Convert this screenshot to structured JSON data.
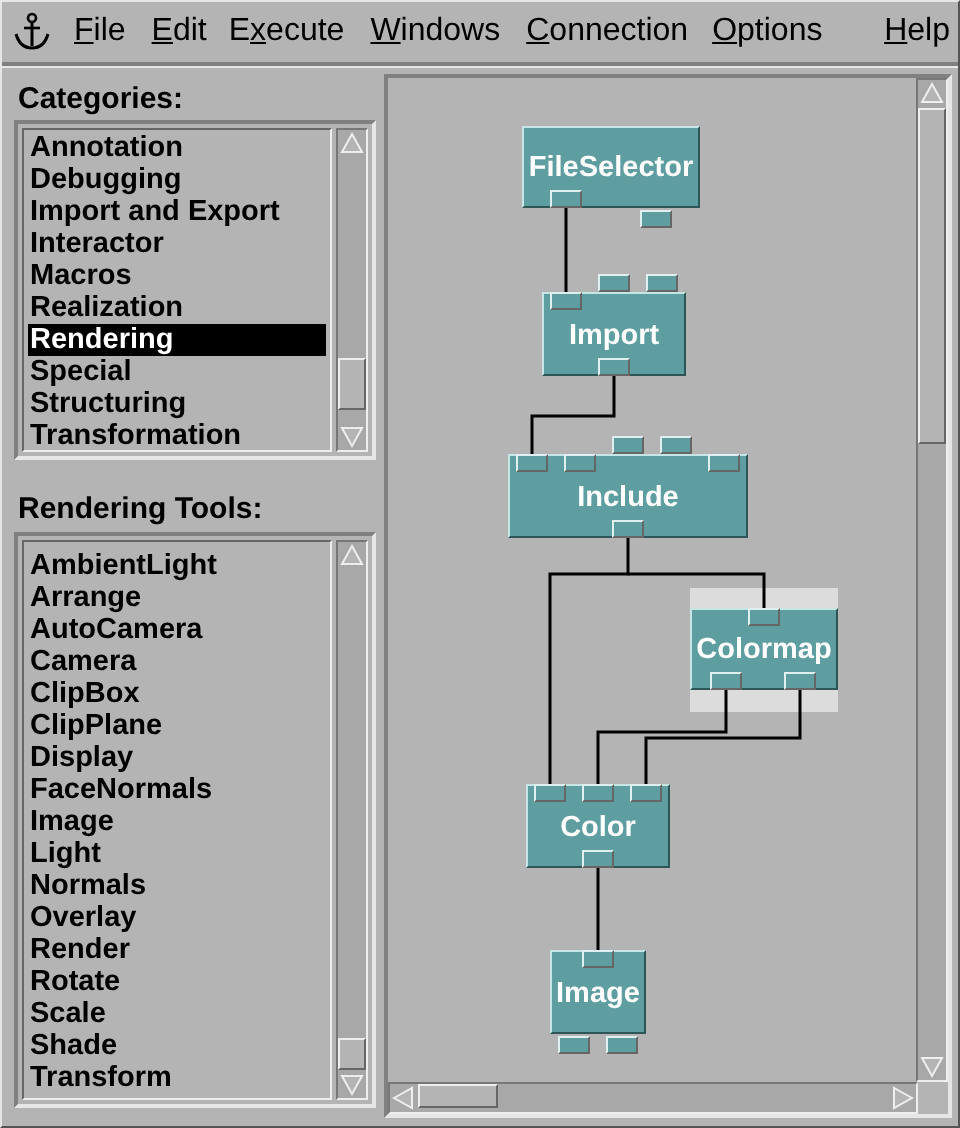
{
  "menu_bar": {
    "items": [
      {
        "label": "File"
      },
      {
        "label": "Edit"
      },
      {
        "label": "Execute"
      },
      {
        "label": "Windows"
      },
      {
        "label": "Connection"
      },
      {
        "label": "Options"
      },
      {
        "label": "Help"
      }
    ]
  },
  "categories": {
    "title": "Categories:",
    "items": [
      {
        "label": "Annotation",
        "selected": false
      },
      {
        "label": "Debugging",
        "selected": false
      },
      {
        "label": "Import and Export",
        "selected": false
      },
      {
        "label": "Interactor",
        "selected": false
      },
      {
        "label": "Macros",
        "selected": false
      },
      {
        "label": "Realization",
        "selected": false
      },
      {
        "label": "Rendering",
        "selected": true
      },
      {
        "label": "Special",
        "selected": false
      },
      {
        "label": "Structuring",
        "selected": false
      },
      {
        "label": "Transformation",
        "selected": false
      }
    ]
  },
  "tools": {
    "title": "Rendering Tools:",
    "items": [
      "AmbientLight",
      "Arrange",
      "AutoCamera",
      "Camera",
      "ClipBox",
      "ClipPlane",
      "Display",
      "FaceNormals",
      "Image",
      "Light",
      "Normals",
      "Overlay",
      "Render",
      "Rotate",
      "Scale",
      "Shade",
      "Transform"
    ]
  },
  "canvas": {
    "nodes": [
      {
        "label": "FileSelector",
        "selected": false
      },
      {
        "label": "Import",
        "selected": false
      },
      {
        "label": "Include",
        "selected": false
      },
      {
        "label": "Colormap",
        "selected": true
      },
      {
        "label": "Color",
        "selected": false
      },
      {
        "label": "Image",
        "selected": false
      }
    ]
  }
}
